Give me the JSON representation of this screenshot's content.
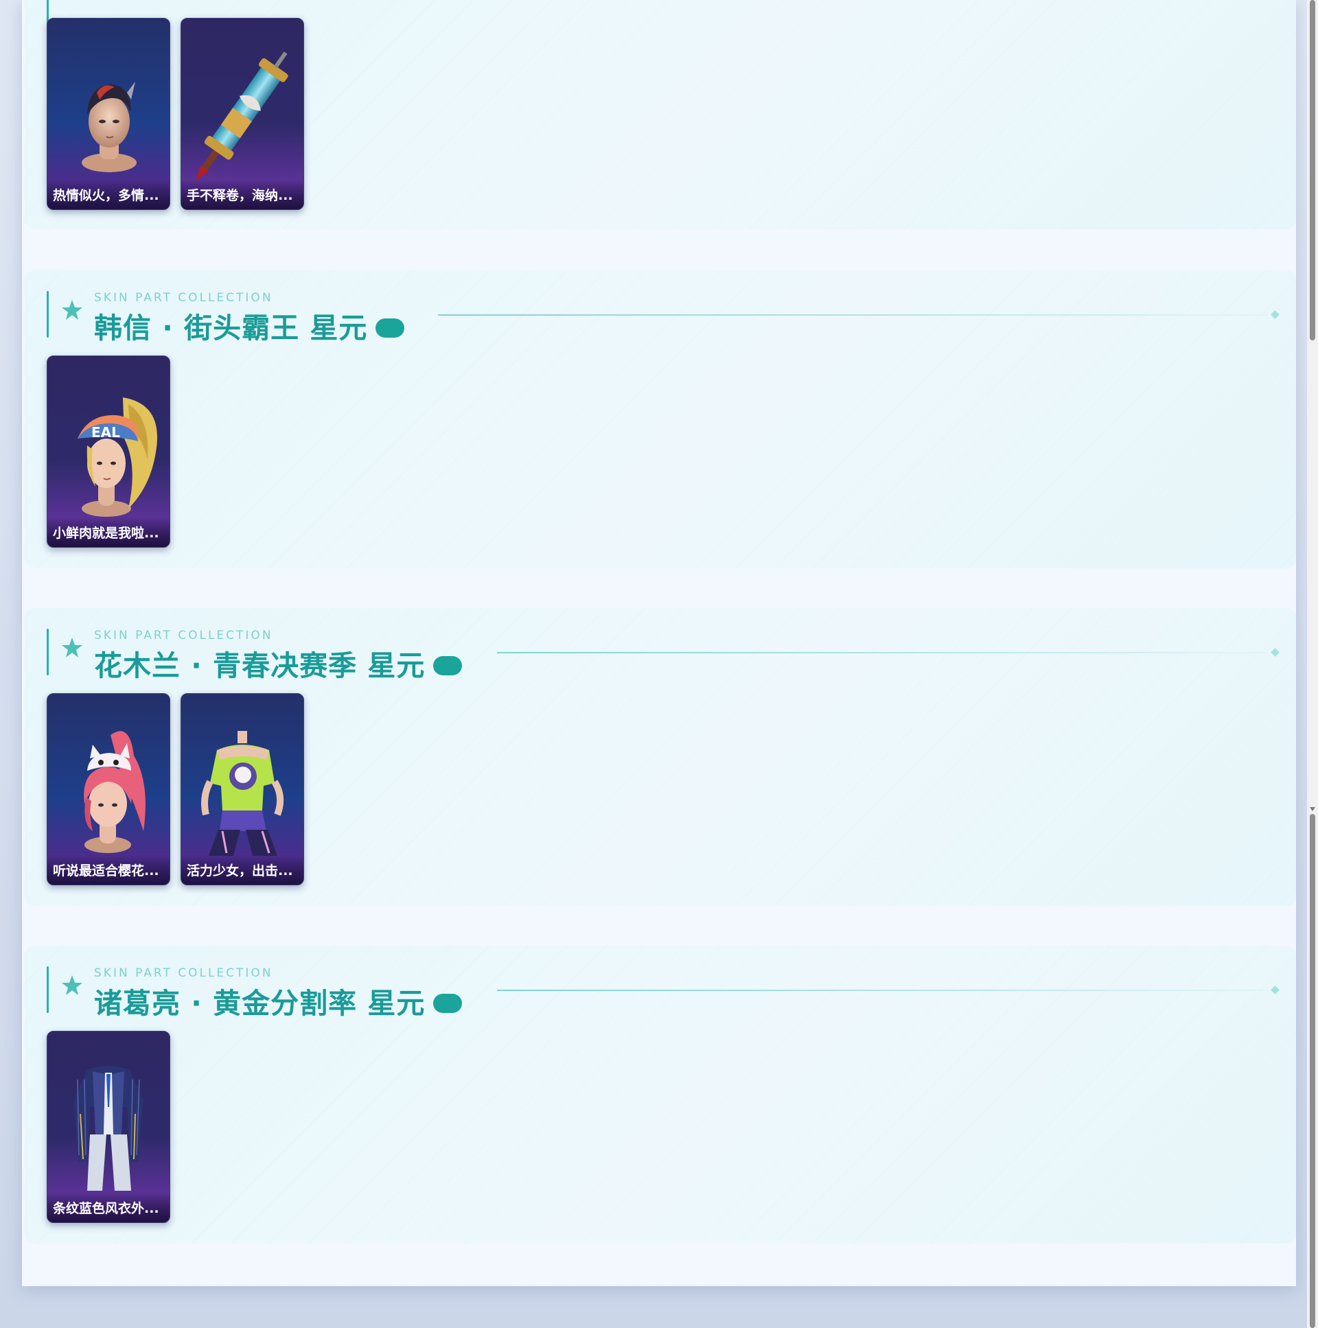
{
  "sections": [
    {
      "eyebrow": "",
      "title": "",
      "cards": [
        {
          "caption": "热情似火，多情...",
          "icon": "hero-head-icon"
        },
        {
          "caption": "手不释卷，海纳...",
          "icon": "scroll-brush-icon"
        }
      ]
    },
    {
      "eyebrow": "SKIN PART COLLECTION",
      "title": "韩信 · 街头霸王 星元",
      "cards": [
        {
          "caption": "小鲜肉就是我啦...",
          "icon": "blonde-cap-head-icon"
        }
      ]
    },
    {
      "eyebrow": "SKIN PART COLLECTION",
      "title": "花木兰 · 青春决赛季 星元",
      "cards": [
        {
          "caption": "听说最适合樱花...",
          "icon": "pink-hair-head-icon"
        },
        {
          "caption": "活力少女，出击...",
          "icon": "sporty-outfit-icon"
        }
      ]
    },
    {
      "eyebrow": "SKIN PART COLLECTION",
      "title": "诸葛亮 · 黄金分割率 星元",
      "cards": [
        {
          "caption": "条纹蓝色风衣外...",
          "icon": "striped-coat-icon"
        }
      ]
    }
  ],
  "colors": {
    "accent": "#1a9b98",
    "eyebrow": "#7fd0cc",
    "pill": "#1aa49a",
    "card_top": "#24306a",
    "card_bottom": "#4b2d8c"
  },
  "scrollbar": {
    "position_fraction": 0.0
  }
}
